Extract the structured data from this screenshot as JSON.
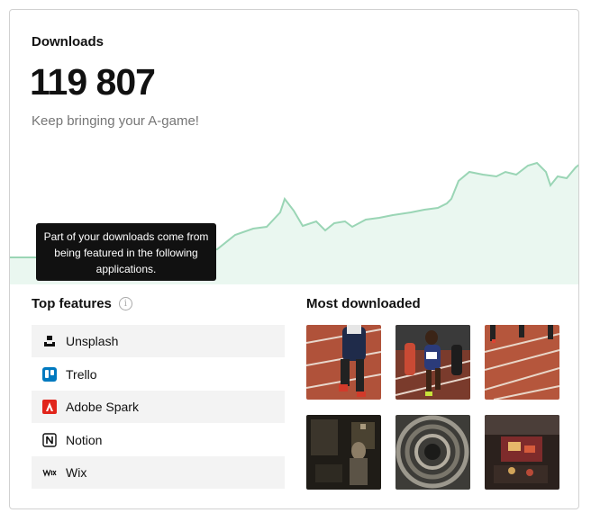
{
  "header": {
    "title": "Downloads",
    "count": "119 807",
    "subtitle": "Keep bringing your A-game!"
  },
  "tooltip": {
    "text": "Part of your downloads come from being featured in the following applications."
  },
  "top_features": {
    "title": "Top features",
    "items": [
      {
        "label": "Unsplash",
        "icon": "unsplash-icon"
      },
      {
        "label": "Trello",
        "icon": "trello-icon"
      },
      {
        "label": "Adobe Spark",
        "icon": "adobe-spark-icon"
      },
      {
        "label": "Notion",
        "icon": "notion-icon"
      },
      {
        "label": "Wix",
        "icon": "wix-icon"
      }
    ]
  },
  "most_downloaded": {
    "title": "Most downloaded",
    "photos": [
      {
        "subject": "runner-on-track"
      },
      {
        "subject": "sprinters-race"
      },
      {
        "subject": "track-lanes-runners"
      },
      {
        "subject": "workshop-interior"
      },
      {
        "subject": "spiral-staircase"
      },
      {
        "subject": "market-stall"
      }
    ]
  },
  "colors": {
    "accent_line": "#9ad5b5",
    "accent_fill": "#eaf7f0",
    "tooltip_bg": "#111111",
    "shaded_row": "#f3f3f3"
  }
}
